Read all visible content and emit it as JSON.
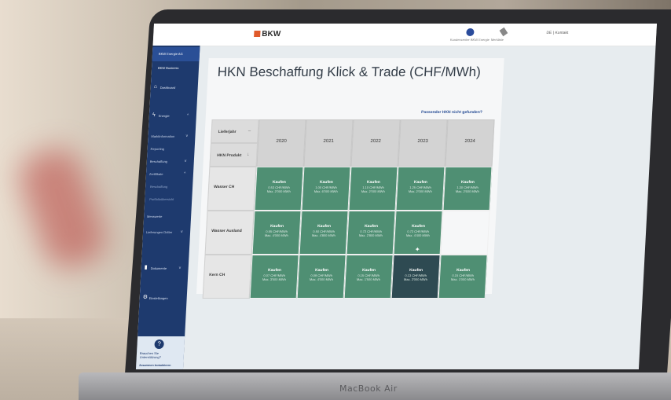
{
  "app": {
    "logo": "BKW",
    "page_title": "HKN Beschaffung Klick & Trade (CHF/MWh)",
    "link_missing": "Passender HKN nicht gefunden?",
    "user_menu": "DE | Kontakt"
  },
  "topbar": {
    "icon_a_caption": "Kundencenter BKW Energie",
    "icon_b_caption": "Merkliste"
  },
  "sidebar": {
    "company": "BKW Energie AG",
    "business": "BKW Business",
    "items": [
      {
        "label": "Dashboard",
        "icon": "home-icon"
      },
      {
        "label": "Energie",
        "icon": "lightning-icon"
      },
      {
        "label": "Marktinformation",
        "level": 1
      },
      {
        "label": "Reporting",
        "level": 1
      },
      {
        "label": "Beschaffung",
        "level": 1
      },
      {
        "label": "Zertifikate",
        "level": 1
      },
      {
        "label": "Beschaffung",
        "level": 2
      },
      {
        "label": "Portfolioübersicht",
        "level": 2
      },
      {
        "label": "Messwerte",
        "level": 1
      },
      {
        "label": "Lieferungen Dritter",
        "level": 1
      },
      {
        "label": "Dokumente",
        "icon": "document-icon"
      },
      {
        "label": "Einstellungen",
        "icon": "gear-icon"
      }
    ],
    "help_icon": "?",
    "help_text": "Brauchen Sie Unterstützung?",
    "help_link": "Zusammen kontaktieren"
  },
  "grid": {
    "header_year_label": "Lieferjahr",
    "header_product_label": "HKN Produkt",
    "years": [
      "2020",
      "2021",
      "2022",
      "2023",
      "2024"
    ],
    "rows": [
      {
        "product": "Wasser CH",
        "cells": [
          {
            "buy": "Kaufen",
            "vol": "0.53 CHF/MWh",
            "max": "Max. 2'000 MWh"
          },
          {
            "buy": "Kaufen",
            "vol": "1.00 CHF/MWh",
            "max": "Max. 6'000 MWh"
          },
          {
            "buy": "Kaufen",
            "vol": "1.10 CHF/MWh",
            "max": "Max. 2'000 MWh"
          },
          {
            "buy": "Kaufen",
            "vol": "1.25 CHF/MWh",
            "max": "Max. 2'000 MWh"
          },
          {
            "buy": "Kaufen",
            "vol": "1.30 CHF/MWh",
            "max": "Max. 2'600 MWh"
          }
        ]
      },
      {
        "product": "Wasser Ausland",
        "cells": [
          {
            "buy": "Kaufen",
            "vol": "0.55 CHF/MWh",
            "max": "Max. 4'000 MWh"
          },
          {
            "buy": "Kaufen",
            "vol": "0.50 CHF/MWh",
            "max": "Max. 4'800 MWh"
          },
          {
            "buy": "Kaufen",
            "vol": "0.72 CHF/MWh",
            "max": "Max. 2'800 MWh"
          },
          {
            "buy": "Kaufen",
            "vol": "0.72 CHF/MWh",
            "max": "Max. 4'400 MWh"
          },
          {
            "buy": "",
            "vol": "",
            "max": ""
          }
        ]
      },
      {
        "product": "Kern CH",
        "cells": [
          {
            "buy": "Kaufen",
            "vol": "0.07 CHF/MWh",
            "max": "Max. 3'500 MWh"
          },
          {
            "buy": "Kaufen",
            "vol": "0.09 CHF/MWh",
            "max": "Max. 4'000 MWh"
          },
          {
            "buy": "Kaufen",
            "vol": "0.15 CHF/MWh",
            "max": "Max. 1'500 MWh"
          },
          {
            "buy": "Kaufen",
            "vol": "0.13 CHF/MWh",
            "max": "Max. 2'000 MWh"
          },
          {
            "buy": "Kaufen",
            "vol": "0.15 CHF/MWh",
            "max": "Max. 1'000 MWh"
          }
        ]
      }
    ]
  },
  "device": {
    "label": "MacBook Air"
  }
}
